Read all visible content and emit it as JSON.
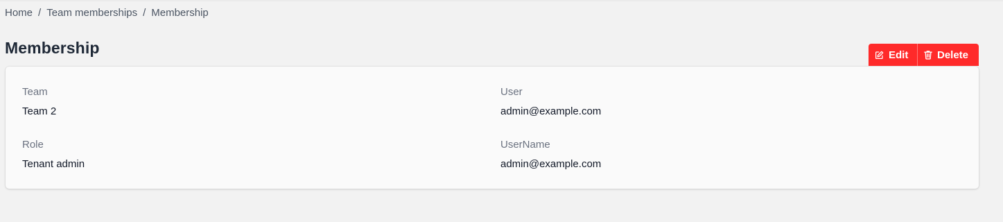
{
  "breadcrumb": {
    "items": [
      "Home",
      "Team memberships",
      "Membership"
    ],
    "separator": "/"
  },
  "page": {
    "title": "Membership"
  },
  "actions": {
    "edit_label": "Edit",
    "delete_label": "Delete",
    "edit_icon": "edit-icon",
    "delete_icon": "trash-icon",
    "button_color": "#ff2a2a"
  },
  "details": {
    "team": {
      "label": "Team",
      "value": "Team 2"
    },
    "user": {
      "label": "User",
      "value": "admin@example.com"
    },
    "role": {
      "label": "Role",
      "value": "Tenant admin"
    },
    "username": {
      "label": "UserName",
      "value": "admin@example.com"
    }
  }
}
